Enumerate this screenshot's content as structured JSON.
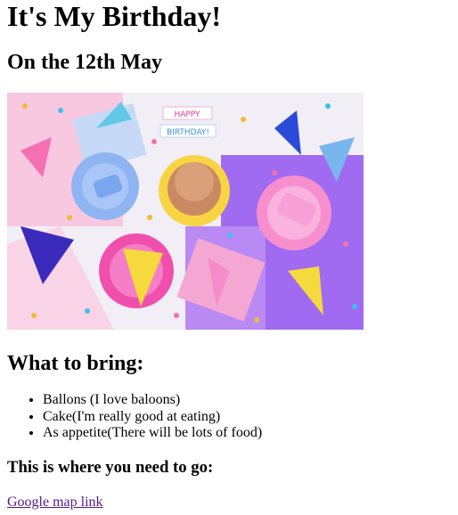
{
  "page": {
    "title": "It's My Birthday!",
    "date_heading": "On the 12th May",
    "hero_image": {
      "subject": "party-flatlay-image",
      "banner_text_top": "HAPPY",
      "banner_text_bottom": "BIRTHDAY!"
    },
    "bring_heading": "What to bring:",
    "bring_items": [
      "Ballons (I love baloons)",
      "Cake(I'm really good at eating)",
      "As appetite(There will be lots of food)"
    ],
    "where_heading": "This is where you need to go:",
    "map_link_text": "Google map link"
  },
  "colors": {
    "link_visited": "#551a8b",
    "text": "#000000",
    "background": "#ffffff"
  }
}
